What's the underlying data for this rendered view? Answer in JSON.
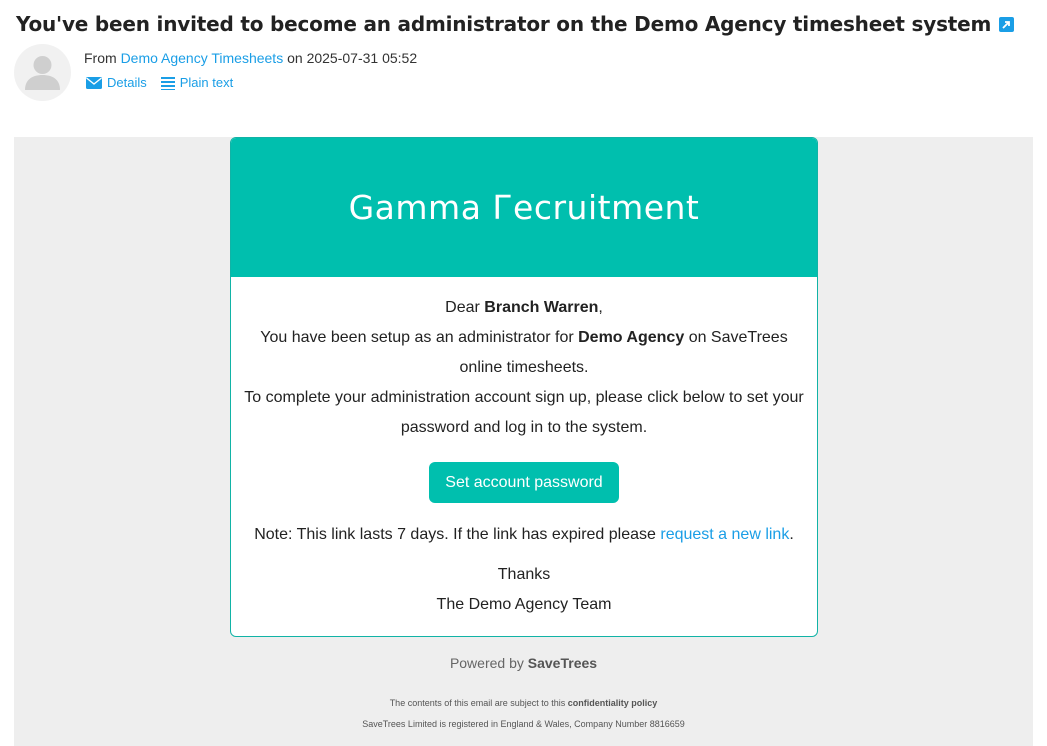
{
  "email": {
    "subject": "You've been invited to become an administrator on the Demo Agency timesheet system",
    "from_prefix": "From",
    "sender": "Demo Agency Timesheets",
    "date_prefix": "on",
    "date": "2025-07-31 05:52",
    "actions": {
      "details": "Details",
      "plain_text": "Plain text"
    }
  },
  "message": {
    "banner_title": "Gamma Гecruitment",
    "greeting_prefix": "Dear",
    "recipient": "Branch Warren",
    "greeting_suffix": ",",
    "line1_prefix": "You have been setup as an administrator for",
    "agency": "Demo Agency",
    "line1_suffix": "on SaveTrees online timesheets.",
    "line2": "To complete your administration account sign up, please click below to set your password and log in to the system.",
    "button_label": "Set account password",
    "note_prefix": "Note: This link lasts 7 days. If the link has expired please",
    "note_link": "request a new link",
    "note_suffix": ".",
    "thanks": "Thanks",
    "signoff": "The Demo Agency Team"
  },
  "footer": {
    "powered_prefix": "Powered by",
    "powered_brand": "SaveTrees",
    "confidentiality_prefix": "The contents of this email are subject to this",
    "confidentiality_link": "confidentiality policy",
    "registration": "SaveTrees Limited is registered in England & Wales, Company Number 8816659"
  },
  "colors": {
    "accent": "#00bfae",
    "link": "#1a9ee6",
    "background": "#eeeeee"
  },
  "icons": {
    "external": "external-link-icon",
    "avatar": "user-avatar-icon",
    "details": "envelope-icon",
    "plain_text": "lines-icon"
  }
}
